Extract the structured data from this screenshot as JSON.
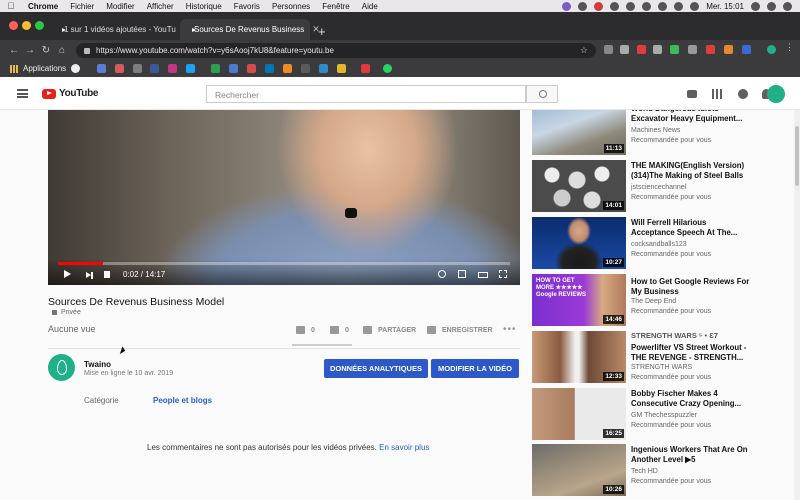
{
  "menubar": {
    "app": "Chrome",
    "items": [
      "Fichier",
      "Modifier",
      "Afficher",
      "Historique",
      "Favoris",
      "Personnes",
      "Fenêtre",
      "Aide"
    ],
    "clock": "Mer. 15:01"
  },
  "tabs": [
    {
      "label": "1 sur 1 vidéos ajoutées - YouTu"
    },
    {
      "label": "Sources De Revenus Business"
    }
  ],
  "browser": {
    "url": "https://www.youtube.com/watch?v=y6sAooj7kU8&feature=youtu.be",
    "bookmarks_apps": "Applications"
  },
  "youtube": {
    "logo": "YouTube",
    "search_placeholder": "Rechercher"
  },
  "video": {
    "time": "0:02 / 14:17",
    "progress": 0.1,
    "title": "Sources De Revenus Business Model",
    "privacy": "Privée",
    "views": "Aucune vue",
    "likes": "0",
    "dislikes": "0",
    "share": "PARTAGER",
    "save": "ENREGISTRER",
    "more": "•••"
  },
  "channel": {
    "name": "Twaino",
    "date": "Mise en ligne le 10 avr. 2019",
    "btn_analytics": "DONNÉES ANALYTIQUES",
    "btn_edit": "MODIFIER LA VIDÉO",
    "category_label": "Catégorie",
    "category_value": "People et blogs"
  },
  "comments": {
    "text": "Les commentaires ne sont pas autorisés pour les vidéos privées.",
    "link": "En savoir plus"
  },
  "sidebar": [
    {
      "title": "World Dangerous Idiots Excavator Heavy Equipment...",
      "channel": "Machines News",
      "rec": "Recommandée pour vous",
      "duration": "11:13"
    },
    {
      "title": "THE MAKING(English Version) (314)The Making of Steel Balls",
      "channel": "jstsciencechannel",
      "rec": "Recommandée pour vous",
      "duration": "14:01"
    },
    {
      "title": "Will Ferrell Hilarious Acceptance Speech At The...",
      "channel": "cocksandballs123",
      "rec": "Recommandée pour vous",
      "duration": "10:27"
    },
    {
      "title": "How to Get Google Reviews For My Business",
      "channel": "The Deep End",
      "rec": "Recommandée pour vous",
      "duration": "14:46"
    },
    {
      "title": "Powerlifter VS Street Workout - THE REVENGE - STRENGTH...",
      "channel": "STRENGTH WARS",
      "rec": "Recommandée pour vous",
      "duration": "12:33"
    },
    {
      "title": "Bobby Fischer Makes 4 Consecutive Crazy Opening...",
      "channel": "GM Thechesspuzzler",
      "rec": "Recommandée pour vous",
      "duration": "16:25"
    },
    {
      "title": "Ingenious Workers That Are On Another Level ▶5",
      "channel": "Tech HD",
      "rec": "Recommandée pour vous",
      "duration": "10:26"
    }
  ],
  "thumb_texts": {
    "strength_overlay": "STRENGTH WARS ⁵ • Ɛ7",
    "google_overlay": "HOW TO GET MORE ★★★★★ Google REVIEWS"
  }
}
